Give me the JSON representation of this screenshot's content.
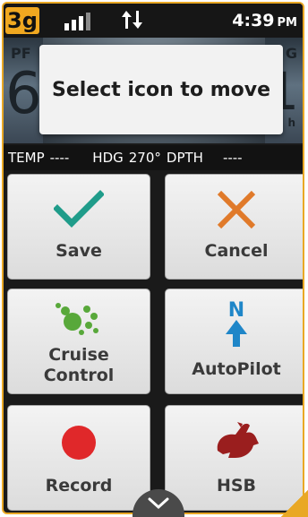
{
  "status_bar": {
    "network_badge": "3g",
    "signal_icon": "signal-bars-icon",
    "data_icon": "data-transfer-arrows-icon",
    "time": "4:39",
    "ampm": "PM"
  },
  "background_gauge": {
    "left_label_partial": "PF",
    "left_value_partial": "6",
    "right_label_partial": "G",
    "right_value_partial": "1",
    "right_unit_partial": "h"
  },
  "toast": {
    "message": "Select icon to move"
  },
  "info_bar": {
    "temp_label": "TEMP",
    "temp_value": "----",
    "hdg_label": "HDG",
    "hdg_value": "270°",
    "dpth_label": "DPTH",
    "dpth_value": "----"
  },
  "tiles": [
    {
      "label": "Save",
      "icon": "checkmark-icon",
      "color": "#1f9c8a"
    },
    {
      "label": "Cancel",
      "icon": "x-icon",
      "color": "#e07a2a"
    },
    {
      "label_line1": "Cruise",
      "label_line2": "Control",
      "icon": "cruise-control-icon",
      "color": "#58a83a"
    },
    {
      "label": "AutoPilot",
      "icon": "autopilot-north-icon",
      "color": "#1f86c8"
    },
    {
      "label": "Record",
      "icon": "record-dot-icon",
      "color": "#e0282a"
    },
    {
      "label": "HSB",
      "icon": "rabbit-icon",
      "color": "#9a1e1e"
    }
  ],
  "footer": {
    "scroll_icon": "chevron-down-icon"
  },
  "colors": {
    "accent": "#e9a825",
    "tile_text": "#3a3a3a"
  }
}
